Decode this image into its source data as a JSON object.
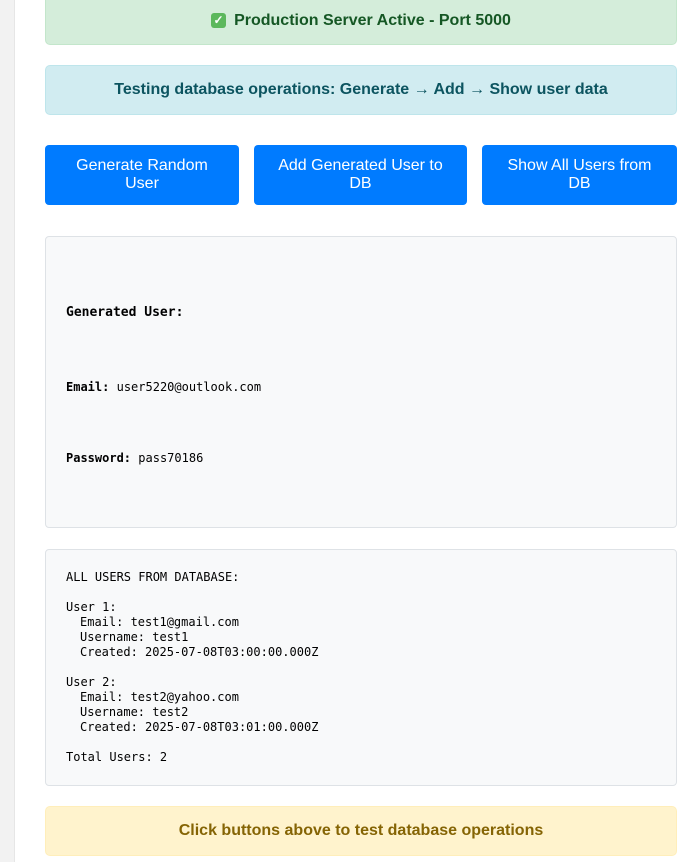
{
  "status": {
    "icon": "check-mark-icon",
    "text": "Production Server Active - Port 5000",
    "color": "#155724"
  },
  "info": {
    "text": "Testing database operations: Generate → Add → Show user data"
  },
  "buttons": {
    "generate_label": "Generate Random User",
    "add_label": "Add Generated User to DB",
    "show_label": "Show All Users from DB",
    "color": "#007bff"
  },
  "generated": {
    "title": "Generated User:",
    "email_label": "Email:",
    "email_value": "user5220@outlook.com",
    "password_label": "Password:",
    "password_value": "pass70186"
  },
  "database": {
    "header": "ALL USERS FROM DATABASE:",
    "users": [
      {
        "title": "User 1:",
        "email": "Email: test1@gmail.com",
        "username": "Username: test1",
        "created": "Created: 2025-07-08T03:00:00.000Z"
      },
      {
        "title": "User 2:",
        "email": "Email: test2@yahoo.com",
        "username": "Username: test2",
        "created": "Created: 2025-07-08T03:01:00.000Z"
      }
    ],
    "total": "Total Users: 2"
  },
  "hint": {
    "text": "Click buttons above to test database operations"
  }
}
